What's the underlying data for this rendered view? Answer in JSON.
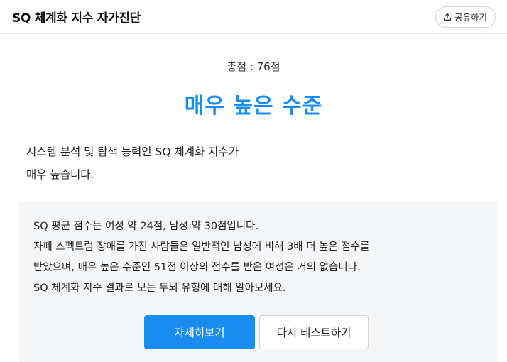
{
  "header": {
    "title": "SQ 체계화 지수 자가진단",
    "share_label": "공유하기",
    "share_icon": "share-upload-icon"
  },
  "result": {
    "score_text": "총점 : 76점",
    "level": "매우 높은 수준",
    "level_color": "#1a8cf0",
    "description_lines": [
      "시스템 분석 및 탐색 능력인 SQ 체계화 지수가",
      "매우 높습니다."
    ]
  },
  "info": {
    "lines": [
      "SQ 평균 점수는 여성 약 24점, 남성 약 30점입니다.",
      "자폐 스펙트럼 장애를 가진 사람들은 일반적인 남성에 비해 3배 더 높은 점수를",
      "받았으며, 매우 높은 수준인 51점 이상의 점수를 받은 여성은 거의 없습니다.",
      "SQ 체계화 지수 결과로 보는 두뇌 유형에 대해 알아보세요."
    ]
  },
  "actions": {
    "details_label": "자세히보기",
    "retry_label": "다시 테스트하기"
  },
  "colors": {
    "accent": "#1a8cf0",
    "info_background": "#f4f6f8"
  }
}
